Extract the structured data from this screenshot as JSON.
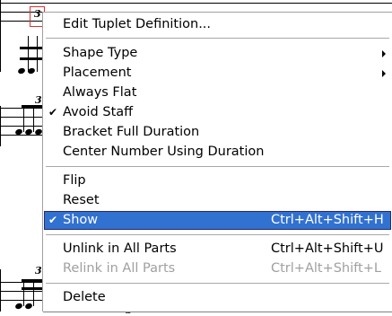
{
  "score": {
    "tuplet_numbers": [
      "3",
      "3",
      "3",
      "3"
    ]
  },
  "menu": {
    "items": [
      {
        "label": "Edit Tuplet Definition...",
        "shortcut": "",
        "checked": false,
        "submenu": false,
        "disabled": false
      },
      {
        "label": "Shape Type",
        "shortcut": "",
        "checked": false,
        "submenu": true,
        "disabled": false
      },
      {
        "label": "Placement",
        "shortcut": "",
        "checked": false,
        "submenu": true,
        "disabled": false
      },
      {
        "label": "Always Flat",
        "shortcut": "",
        "checked": false,
        "submenu": false,
        "disabled": false
      },
      {
        "label": "Avoid Staff",
        "shortcut": "",
        "checked": true,
        "submenu": false,
        "disabled": false
      },
      {
        "label": "Bracket Full Duration",
        "shortcut": "",
        "checked": false,
        "submenu": false,
        "disabled": false
      },
      {
        "label": "Center Number Using Duration",
        "shortcut": "",
        "checked": false,
        "submenu": false,
        "disabled": false
      },
      {
        "label": "Flip",
        "shortcut": "",
        "checked": false,
        "submenu": false,
        "disabled": false
      },
      {
        "label": "Reset",
        "shortcut": "",
        "checked": false,
        "submenu": false,
        "disabled": false
      },
      {
        "label": "Show",
        "shortcut": "Ctrl+Alt+Shift+H",
        "checked": true,
        "submenu": false,
        "disabled": false,
        "highlighted": true
      },
      {
        "label": "Unlink in All Parts",
        "shortcut": "Ctrl+Alt+Shift+U",
        "checked": false,
        "submenu": false,
        "disabled": false
      },
      {
        "label": "Relink in All Parts",
        "shortcut": "Ctrl+Alt+Shift+L",
        "checked": false,
        "submenu": false,
        "disabled": true
      },
      {
        "label": "Delete",
        "shortcut": "",
        "checked": false,
        "submenu": false,
        "disabled": false
      }
    ],
    "check_glyph": "✔",
    "colors": {
      "highlight": "#3171d0",
      "disabled": "#a0a0a0",
      "selection_box": "#e03030"
    }
  }
}
